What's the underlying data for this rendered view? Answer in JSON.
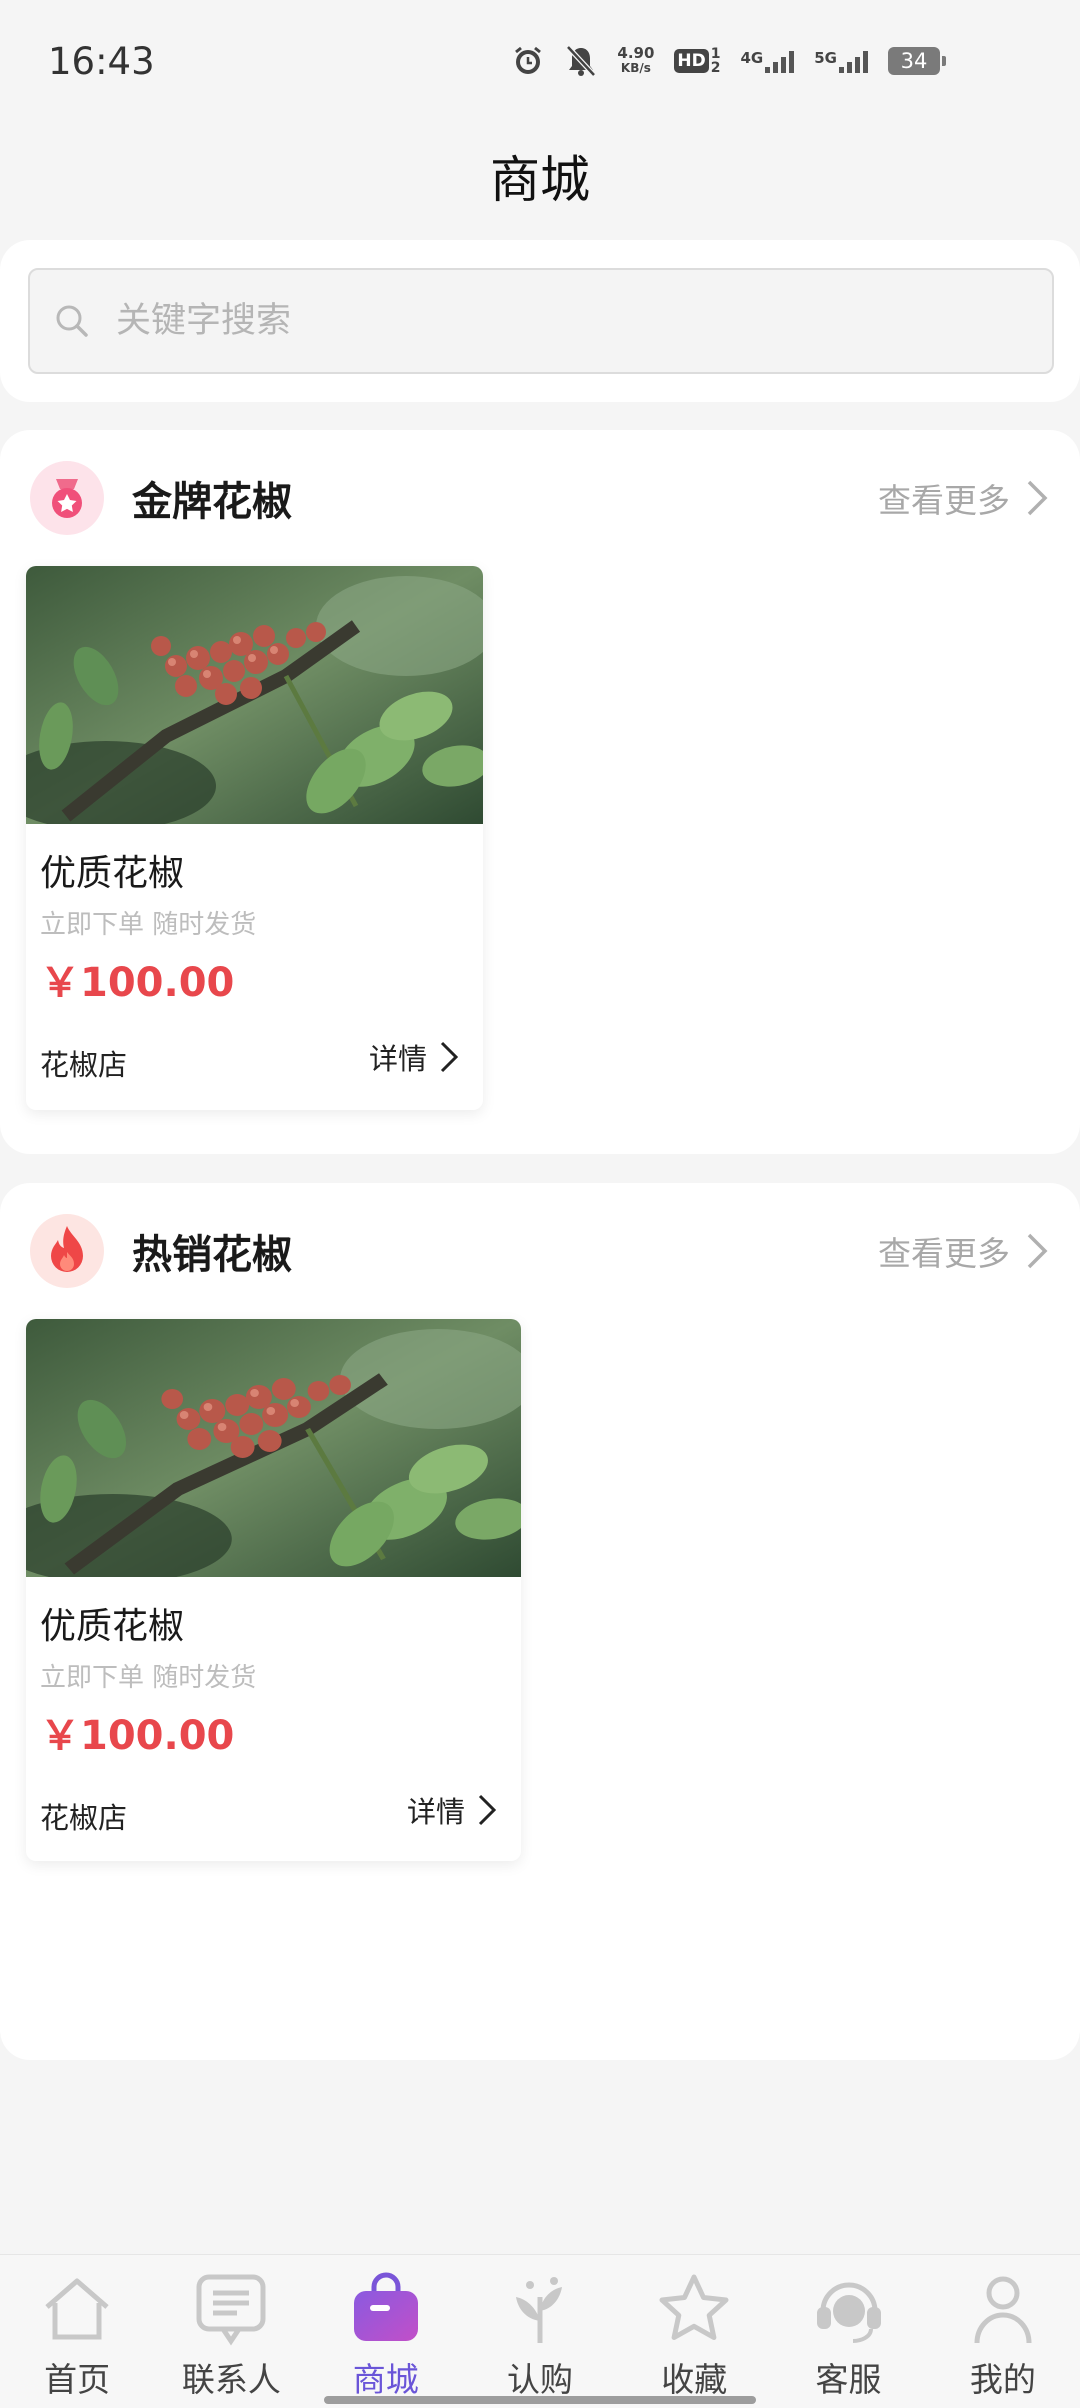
{
  "status_bar": {
    "time": "16:43",
    "net_speed_top": "4.90",
    "net_speed_bottom": "KB/s",
    "hd": "HD",
    "hd_sub_top": "1",
    "hd_sub_bottom": "2",
    "signal_1": "4G",
    "signal_2": "5G",
    "battery": "34"
  },
  "header": {
    "title": "商城"
  },
  "search": {
    "placeholder": "关键字搜索"
  },
  "sections": [
    {
      "title": "金牌花椒",
      "more_label": "查看更多",
      "icon": "medal-icon",
      "icon_color": "#f0507a",
      "product": {
        "name": "优质花椒",
        "subtitle": "立即下单 随时发货",
        "price": "￥100.00",
        "shop": "花椒店",
        "detail_label": "详情"
      }
    },
    {
      "title": "热销花椒",
      "more_label": "查看更多",
      "icon": "flame-icon",
      "icon_color": "#ef4747",
      "product": {
        "name": "优质花椒",
        "subtitle": "立即下单 随时发货",
        "price": "￥100.00",
        "shop": "花椒店",
        "detail_label": "详情"
      }
    }
  ],
  "bottom_nav": {
    "active_color": "#6a55d8",
    "items": [
      {
        "label": "首页",
        "icon": "home-icon"
      },
      {
        "label": "联系人",
        "icon": "contacts-icon"
      },
      {
        "label": "商城",
        "icon": "shopping-bag-icon",
        "active": true
      },
      {
        "label": "认购",
        "icon": "plant-icon"
      },
      {
        "label": "收藏",
        "icon": "star-icon"
      },
      {
        "label": "客服",
        "icon": "headset-icon"
      },
      {
        "label": "我的",
        "icon": "person-icon"
      }
    ]
  }
}
